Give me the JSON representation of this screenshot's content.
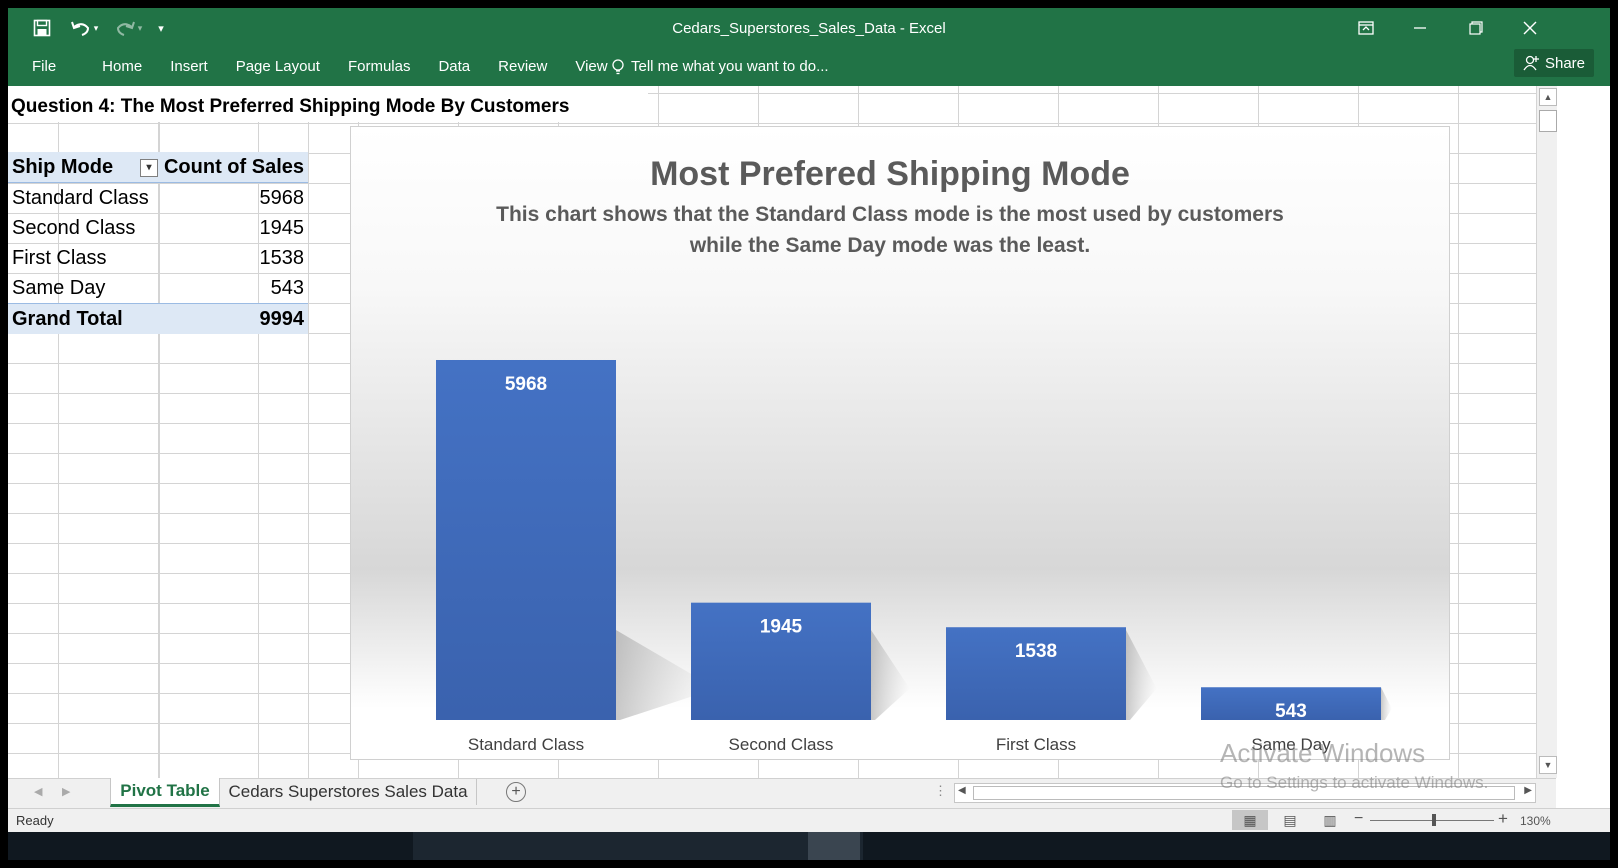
{
  "window": {
    "title": "Cedars_Superstores_Sales_Data - Excel",
    "share_label": "Share",
    "tell_me": "Tell me what you want to do..."
  },
  "ribbon": {
    "tabs": [
      "File",
      "Home",
      "Insert",
      "Page Layout",
      "Formulas",
      "Data",
      "Review",
      "View"
    ]
  },
  "sheet": {
    "question_title": "Question 4: The Most Preferred Shipping Mode By Customers",
    "pivot": {
      "headers": [
        "Ship Mode",
        "Count of Sales"
      ],
      "rows": [
        {
          "mode": "Standard Class",
          "count": "5968"
        },
        {
          "mode": "Second Class",
          "count": "1945"
        },
        {
          "mode": "First Class",
          "count": "1538"
        },
        {
          "mode": "Same Day",
          "count": "543"
        }
      ],
      "total_label": "Grand Total",
      "total_value": "9994"
    }
  },
  "chart_data": {
    "type": "bar",
    "title": "Most Prefered Shipping Mode",
    "subtitle_line1": "This chart shows that the Standard Class mode is the most used by customers",
    "subtitle_line2": "while the Same Day mode was the least.",
    "categories": [
      "Standard Class",
      "Second Class",
      "First Class",
      "Same Day"
    ],
    "values": [
      5968,
      1945,
      1538,
      543
    ],
    "ylim": [
      0,
      5968
    ],
    "bar_color": "#4472C4",
    "data_labels": true,
    "grid": false,
    "legend": "none"
  },
  "sheet_tabs": {
    "active": "Pivot Table",
    "other": "Cedars Superstores Sales Data"
  },
  "watermark": {
    "line1": "Activate Windows",
    "line2": "Go to Settings to activate Windows."
  },
  "status": {
    "ready": "Ready",
    "zoom": "130%"
  },
  "colors": {
    "excel_green": "#217346",
    "pivot_header_bg": "#DDE8F5"
  }
}
